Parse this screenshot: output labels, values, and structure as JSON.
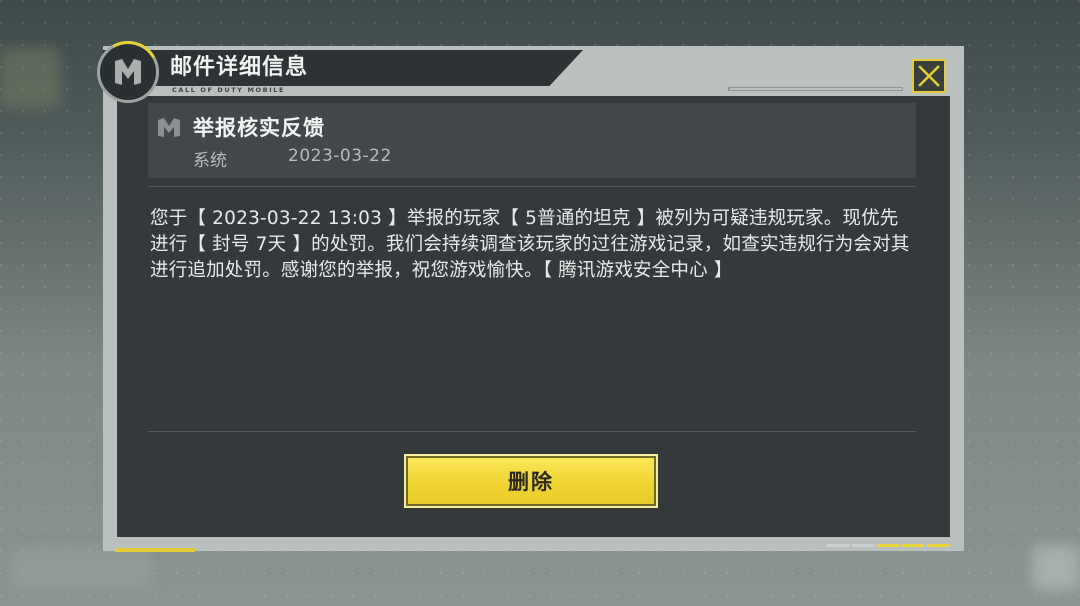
{
  "dialog": {
    "title": "邮件详细信息",
    "brand_text": "CALL OF DUTY MOBILE",
    "logo_icon": "cod-m-logo-icon",
    "close_icon": "close-x-icon",
    "accent_color": "#e9d13a"
  },
  "mail": {
    "icon": "mail-system-icon",
    "subject": "举报核实反馈",
    "sender": "系统",
    "date": "2023-03-22",
    "body": "您于【 2023-03-22 13:03 】举报的玩家【 5普通的坦克 】被列为可疑违规玩家。现优先进行【 封号 7天 】的处罚。我们会持续调查该玩家的过往游戏记录，如查实违规行为会对其进行追加处罚。感谢您的举报，祝您游戏愉快。【 腾讯游戏安全中心 】"
  },
  "actions": {
    "delete_label": "删除"
  }
}
